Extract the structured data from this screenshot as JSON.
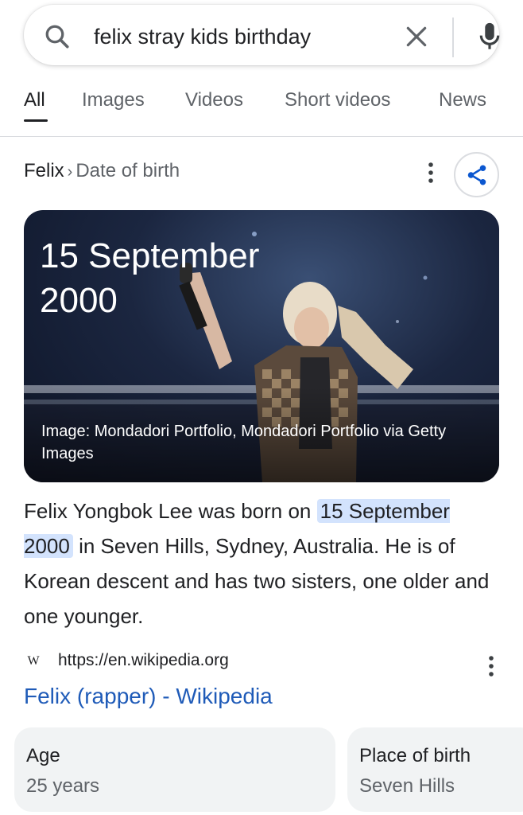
{
  "search": {
    "query": "felix stray kids birthday",
    "icons": {
      "search": "search-icon",
      "clear": "close-icon",
      "mic": "mic-icon"
    }
  },
  "tabs": [
    {
      "label": "All",
      "active": true
    },
    {
      "label": "Images"
    },
    {
      "label": "Videos"
    },
    {
      "label": "Short videos"
    },
    {
      "label": "News"
    }
  ],
  "breadcrumb": {
    "root": "Felix",
    "separator": "›",
    "leaf": "Date of birth"
  },
  "answer": {
    "title": "15 September 2000",
    "image_caption": "Image: Mondadori Portfolio, Mondadori Portfolio via Getty Images"
  },
  "description": {
    "before": "Felix Yongbok Lee was born on ",
    "highlight": "15 September 2000",
    "after": " in Seven Hills, Sydney, Australia. He is of Korean descent and has two sisters, one older and one younger."
  },
  "source": {
    "favicon": "W",
    "url": "https://en.wikipedia.org",
    "title": "Felix (rapper) - Wikipedia"
  },
  "facts": [
    {
      "label": "Age",
      "value": "25 years"
    },
    {
      "label": "Place of birth",
      "value": "Seven Hills"
    }
  ],
  "colors": {
    "link": "#1f5bb8",
    "highlight": "#d3e3fd",
    "chip_bg": "#f1f3f4",
    "share_blue": "#0b57d0"
  }
}
